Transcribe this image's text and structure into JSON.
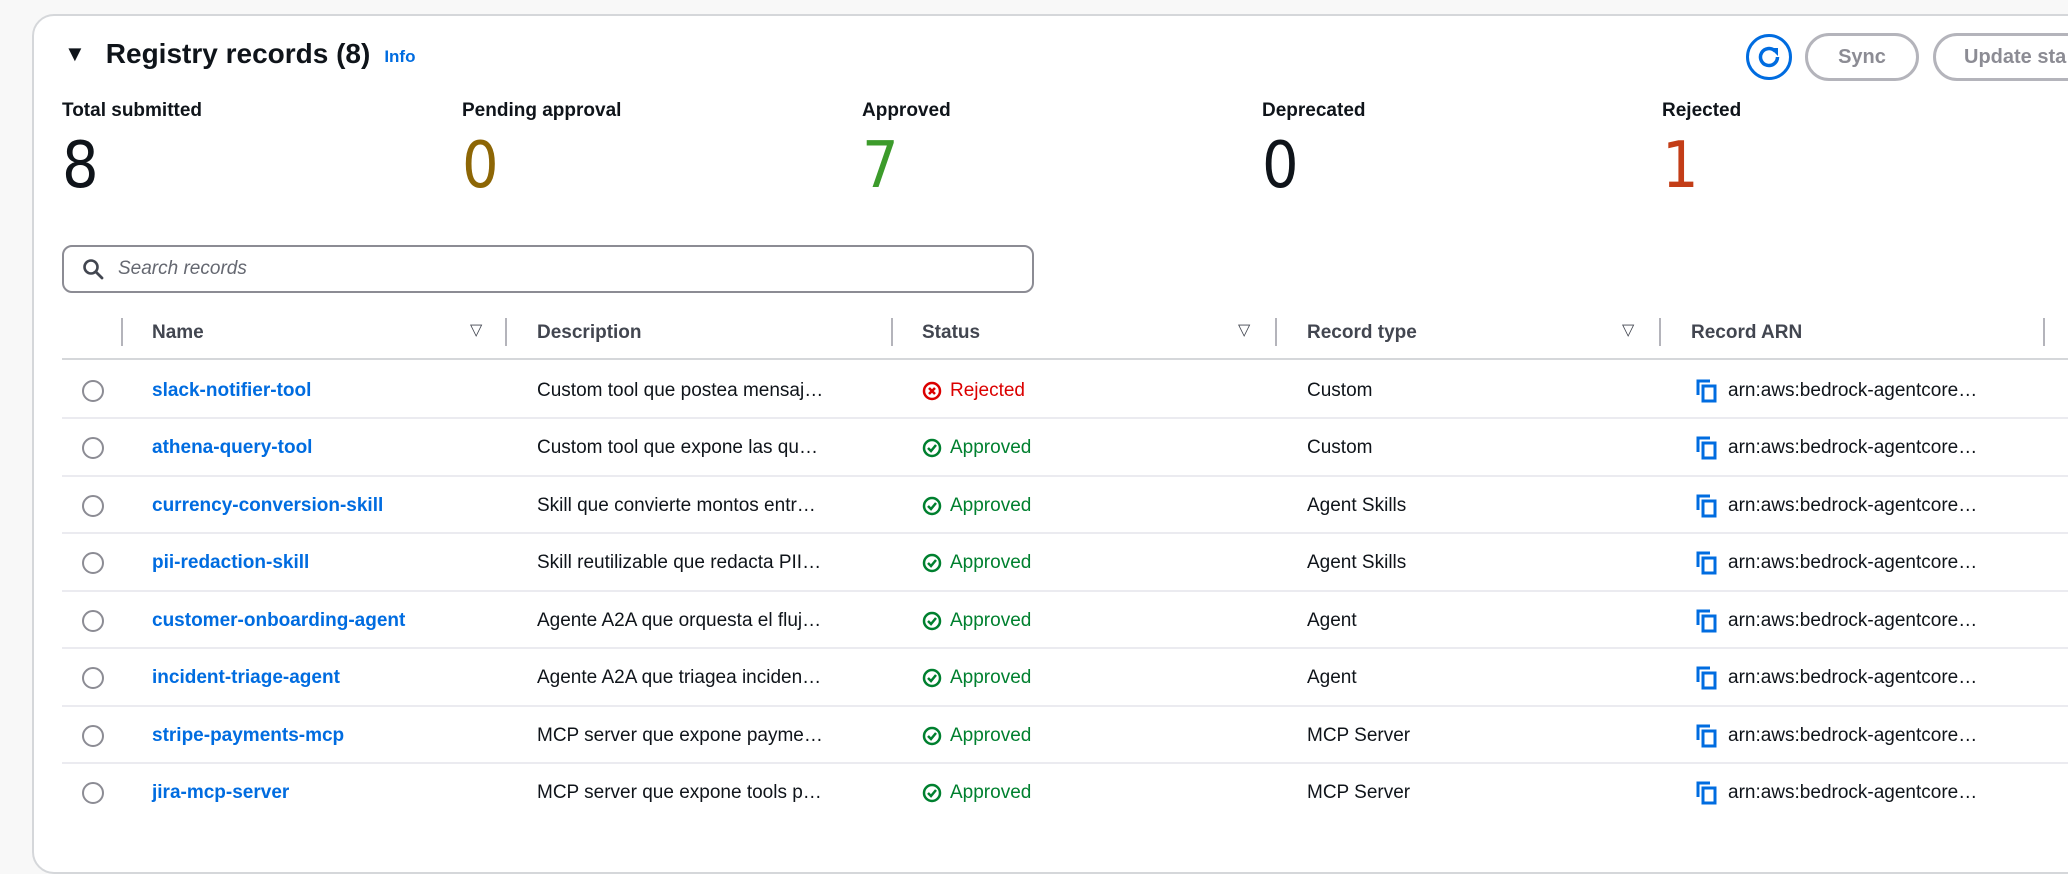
{
  "header": {
    "title": "Registry records (8)",
    "info_label": "Info",
    "sync_label": "Sync",
    "update_label": "Update sta"
  },
  "stats": [
    {
      "label": "Total submitted",
      "value": "8",
      "color": "#0f141a"
    },
    {
      "label": "Pending approval",
      "value": "0",
      "color": "#8d6605"
    },
    {
      "label": "Approved",
      "value": "7",
      "color": "#3c9b2b"
    },
    {
      "label": "Deprecated",
      "value": "0",
      "color": "#0f141a"
    },
    {
      "label": "Rejected",
      "value": "1",
      "color": "#c33d17"
    }
  ],
  "search": {
    "placeholder": "Search records",
    "value": ""
  },
  "table": {
    "columns": [
      "Name",
      "Description",
      "Status",
      "Record type",
      "Record ARN"
    ],
    "rows": [
      {
        "name": "slack-notifier-tool",
        "description": "Custom tool que postea mensaj…",
        "status": "Rejected",
        "type": "Custom",
        "arn": "arn:aws:bedrock-agentcore…"
      },
      {
        "name": "athena-query-tool",
        "description": "Custom tool que expone las qu…",
        "status": "Approved",
        "type": "Custom",
        "arn": "arn:aws:bedrock-agentcore…"
      },
      {
        "name": "currency-conversion-skill",
        "description": "Skill que convierte montos entr…",
        "status": "Approved",
        "type": "Agent Skills",
        "arn": "arn:aws:bedrock-agentcore…"
      },
      {
        "name": "pii-redaction-skill",
        "description": "Skill reutilizable que redacta PII…",
        "status": "Approved",
        "type": "Agent Skills",
        "arn": "arn:aws:bedrock-agentcore…"
      },
      {
        "name": "customer-onboarding-agent",
        "description": "Agente A2A que orquesta el fluj…",
        "status": "Approved",
        "type": "Agent",
        "arn": "arn:aws:bedrock-agentcore…"
      },
      {
        "name": "incident-triage-agent",
        "description": "Agente A2A que triagea inciden…",
        "status": "Approved",
        "type": "Agent",
        "arn": "arn:aws:bedrock-agentcore…"
      },
      {
        "name": "stripe-payments-mcp",
        "description": "MCP server que expone payme…",
        "status": "Approved",
        "type": "MCP Server",
        "arn": "arn:aws:bedrock-agentcore…"
      },
      {
        "name": "jira-mcp-server",
        "description": "MCP server que expone tools p…",
        "status": "Approved",
        "type": "MCP Server",
        "arn": "arn:aws:bedrock-agentcore…"
      }
    ]
  }
}
